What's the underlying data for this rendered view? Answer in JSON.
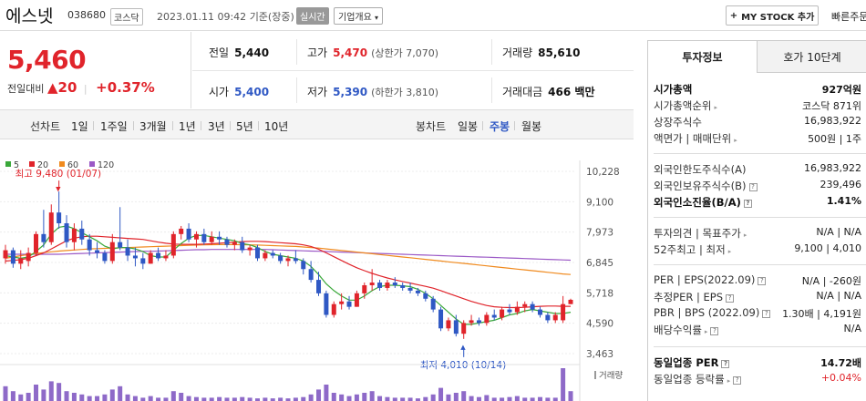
{
  "header": {
    "name": "에스넷",
    "code": "038680",
    "market": "코스닥",
    "datetime": "2023.01.11 09:42",
    "basis": "기준(장중)",
    "realtime": "실시간",
    "company_btn": "기업개요",
    "mystock_btn": "MY STOCK 추가",
    "quick": "빠른주문"
  },
  "price": {
    "now": "5,460",
    "change_label": "전일대비",
    "change_val": "20",
    "change_pct": "+0.37%"
  },
  "stats": {
    "prev_close_lbl": "전일",
    "prev_close": "5,440",
    "high_lbl": "고가",
    "high": "5,470",
    "upper_limit": "(상한가 7,070)",
    "volume_lbl": "거래량",
    "volume": "85,610",
    "open_lbl": "시가",
    "open": "5,400",
    "low_lbl": "저가",
    "low": "5,390",
    "lower_limit": "(하한가 3,810)",
    "amount_lbl": "거래대금",
    "amount": "466 백만"
  },
  "toolbar": {
    "line_label": "선차트",
    "periods": [
      "1일",
      "1주일",
      "3개월",
      "1년",
      "3년",
      "5년",
      "10년"
    ],
    "candle_label": "봉차트",
    "candles": [
      "일봉",
      "주봉",
      "월봉"
    ],
    "candle_active": "주봉"
  },
  "colors": {
    "up": "#e0242b",
    "down": "#2f58c4",
    "ma5": "#3aa83a",
    "ma20": "#e0242b",
    "ma60": "#f08a1e",
    "ma120": "#9b59c6",
    "volume": "#8e6ac8"
  },
  "chart_data": {
    "type": "candlestick",
    "legend": [
      "5",
      "20",
      "60",
      "120"
    ],
    "yticks": [
      "10,228",
      "9,100",
      "7,973",
      "6,845",
      "5,718",
      "4,590",
      "3,463"
    ],
    "ylim": [
      3463,
      10228
    ],
    "high_note": "최고 9,480 (01/07)",
    "low_note": "최저 4,010 (10/14)",
    "volume_label": "거래량",
    "candles": [
      [
        7000,
        7500,
        6800,
        7300
      ],
      [
        7300,
        7400,
        6650,
        6800
      ],
      [
        6800,
        7300,
        6600,
        7000
      ],
      [
        6900,
        7400,
        6700,
        7200
      ],
      [
        7200,
        8000,
        7100,
        7900
      ],
      [
        7900,
        8800,
        7400,
        7600
      ],
      [
        7600,
        9000,
        7500,
        8700
      ],
      [
        8700,
        9480,
        8100,
        8300
      ],
      [
        8300,
        8600,
        7400,
        7600
      ],
      [
        7600,
        8300,
        7300,
        8100
      ],
      [
        8100,
        8400,
        7500,
        7700
      ],
      [
        7700,
        7900,
        7100,
        7300
      ],
      [
        7300,
        7600,
        7000,
        7200
      ],
      [
        7200,
        7300,
        6800,
        6900
      ],
      [
        6900,
        7900,
        6800,
        7600
      ],
      [
        7600,
        8900,
        7300,
        7400
      ],
      [
        7400,
        7700,
        6900,
        7100
      ],
      [
        7100,
        7400,
        6700,
        7000
      ],
      [
        7000,
        7200,
        6600,
        6800
      ],
      [
        6800,
        7300,
        6800,
        7200
      ],
      [
        7200,
        7400,
        6900,
        7000
      ],
      [
        7000,
        7300,
        6900,
        7100
      ],
      [
        7100,
        8000,
        7000,
        7900
      ],
      [
        7900,
        8200,
        7700,
        8100
      ],
      [
        8100,
        8300,
        7600,
        7700
      ],
      [
        7700,
        8000,
        7400,
        7900
      ],
      [
        7900,
        8100,
        7500,
        7600
      ],
      [
        7600,
        8000,
        7500,
        7800
      ],
      [
        7800,
        8000,
        7500,
        7700
      ],
      [
        7700,
        7800,
        7400,
        7500
      ],
      [
        7500,
        7700,
        7300,
        7600
      ],
      [
        7600,
        7800,
        7200,
        7300
      ],
      [
        7300,
        7500,
        7100,
        7400
      ],
      [
        7400,
        7500,
        6900,
        7000
      ],
      [
        7000,
        7300,
        6900,
        7200
      ],
      [
        7200,
        7300,
        7000,
        7100
      ],
      [
        7100,
        7200,
        6800,
        6900
      ],
      [
        6900,
        7100,
        6700,
        7000
      ],
      [
        7000,
        7300,
        6800,
        6900
      ],
      [
        6900,
        7000,
        6400,
        6600
      ],
      [
        6600,
        6900,
        6100,
        6200
      ],
      [
        6200,
        6500,
        5600,
        5700
      ],
      [
        5700,
        5800,
        4800,
        4900
      ],
      [
        4900,
        5400,
        4800,
        5300
      ],
      [
        5300,
        5700,
        5100,
        5400
      ],
      [
        5400,
        5600,
        5100,
        5200
      ],
      [
        5200,
        5800,
        5200,
        5700
      ],
      [
        5700,
        6100,
        5500,
        6000
      ],
      [
        6000,
        6600,
        5800,
        6100
      ],
      [
        6100,
        6200,
        5800,
        5900
      ],
      [
        5900,
        6200,
        5800,
        6100
      ],
      [
        6100,
        6300,
        5900,
        6000
      ],
      [
        6000,
        6100,
        5800,
        5900
      ],
      [
        5900,
        6100,
        5700,
        5800
      ],
      [
        5800,
        5900,
        5600,
        5700
      ],
      [
        5700,
        5800,
        5400,
        5500
      ],
      [
        5500,
        5600,
        5000,
        5100
      ],
      [
        5100,
        5200,
        4300,
        4400
      ],
      [
        4400,
        4800,
        4300,
        4700
      ],
      [
        4700,
        4900,
        4100,
        4200
      ],
      [
        4200,
        4700,
        4010,
        4600
      ],
      [
        4600,
        4900,
        4500,
        4700
      ],
      [
        4700,
        4800,
        4500,
        4600
      ],
      [
        4600,
        5000,
        4500,
        4900
      ],
      [
        4900,
        5100,
        4700,
        4800
      ],
      [
        4800,
        5200,
        4700,
        5100
      ],
      [
        5100,
        5300,
        4900,
        5000
      ],
      [
        5000,
        5400,
        4900,
        5200
      ],
      [
        5200,
        5400,
        5000,
        5300
      ],
      [
        5300,
        5400,
        5000,
        5100
      ],
      [
        5100,
        5200,
        4800,
        4900
      ],
      [
        4900,
        5000,
        4600,
        4700
      ],
      [
        4700,
        5000,
        4600,
        4900
      ],
      [
        4700,
        5600,
        4600,
        5300
      ],
      [
        5300,
        5500,
        5300,
        5460
      ]
    ],
    "ma5": [
      7100,
      7050,
      7000,
      7050,
      7250,
      7500,
      7900,
      8150,
      8200,
      8100,
      7950,
      7800,
      7650,
      7450,
      7350,
      7400,
      7400,
      7350,
      7250,
      7100,
      7050,
      7050,
      7300,
      7550,
      7750,
      7850,
      7850,
      7800,
      7750,
      7700,
      7650,
      7550,
      7500,
      7400,
      7250,
      7150,
      7100,
      7050,
      7000,
      6900,
      6700,
      6400,
      6050,
      5800,
      5600,
      5450,
      5450,
      5600,
      5800,
      5950,
      6000,
      6000,
      5980,
      5950,
      5850,
      5700,
      5500,
      5250,
      5000,
      4750,
      4550,
      4550,
      4600,
      4650,
      4700,
      4800,
      4900,
      4950,
      5050,
      5100,
      5050,
      5000,
      4950,
      4950,
      5000
    ],
    "ma20": [
      6900,
      6920,
      6950,
      7000,
      7100,
      7200,
      7350,
      7500,
      7650,
      7750,
      7800,
      7820,
      7820,
      7800,
      7780,
      7760,
      7740,
      7720,
      7700,
      7650,
      7600,
      7560,
      7530,
      7520,
      7520,
      7520,
      7530,
      7540,
      7560,
      7580,
      7600,
      7620,
      7630,
      7630,
      7620,
      7600,
      7580,
      7560,
      7540,
      7500,
      7440,
      7340,
      7200,
      7060,
      6920,
      6780,
      6650,
      6540,
      6440,
      6350,
      6270,
      6200,
      6140,
      6080,
      6020,
      5960,
      5890,
      5800,
      5700,
      5600,
      5500,
      5400,
      5320,
      5250,
      5200,
      5180,
      5170,
      5170,
      5180,
      5200,
      5220,
      5230,
      5230,
      5220,
      5220
    ],
    "ma60": [
      7000,
      7050,
      7100,
      7140,
      7180,
      7210,
      7240,
      7270,
      7290,
      7310,
      7330,
      7350,
      7360,
      7370,
      7380,
      7390,
      7400,
      7410,
      7420,
      7430,
      7440,
      7450,
      7460,
      7470,
      7480,
      7490,
      7500,
      7505,
      7510,
      7510,
      7510,
      7505,
      7500,
      7490,
      7480,
      7470,
      7460,
      7450,
      7440,
      7420,
      7400,
      7380,
      7350,
      7320,
      7290,
      7260,
      7230,
      7200,
      7170,
      7140,
      7110,
      7080,
      7050,
      7020,
      6990,
      6960,
      6930,
      6900,
      6870,
      6840,
      6810,
      6780,
      6750,
      6720,
      6690,
      6660,
      6630,
      6600,
      6570,
      6540,
      6510,
      6480,
      6450,
      6420,
      6400
    ],
    "ma120": [
      7150,
      7150,
      7150,
      7150,
      7150,
      7150,
      7150,
      7150,
      7160,
      7170,
      7180,
      7190,
      7200,
      7210,
      7220,
      7230,
      7240,
      7250,
      7260,
      7260,
      7270,
      7280,
      7290,
      7300,
      7310,
      7320,
      7320,
      7330,
      7330,
      7330,
      7330,
      7330,
      7330,
      7330,
      7330,
      7320,
      7310,
      7300,
      7290,
      7280,
      7270,
      7260,
      7250,
      7240,
      7230,
      7220,
      7210,
      7200,
      7190,
      7180,
      7170,
      7160,
      7150,
      7140,
      7130,
      7120,
      7110,
      7100,
      7090,
      7080,
      7070,
      7060,
      7050,
      7040,
      7030,
      7020,
      7010,
      7000,
      6990,
      6980,
      6970,
      6960,
      6950,
      6940,
      6930
    ],
    "volumes": [
      0.45,
      0.3,
      0.2,
      0.25,
      0.5,
      0.35,
      0.6,
      0.55,
      0.3,
      0.25,
      0.2,
      0.15,
      0.15,
      0.2,
      0.35,
      0.45,
      0.2,
      0.15,
      0.1,
      0.15,
      0.1,
      0.1,
      0.3,
      0.25,
      0.15,
      0.12,
      0.1,
      0.1,
      0.12,
      0.1,
      0.1,
      0.12,
      0.1,
      0.08,
      0.1,
      0.08,
      0.1,
      0.08,
      0.1,
      0.12,
      0.2,
      0.35,
      0.5,
      0.25,
      0.2,
      0.15,
      0.2,
      0.25,
      0.3,
      0.15,
      0.12,
      0.1,
      0.1,
      0.1,
      0.08,
      0.12,
      0.2,
      0.4,
      0.2,
      0.25,
      0.3,
      0.15,
      0.12,
      0.18,
      0.1,
      0.1,
      0.12,
      0.15,
      0.1,
      0.1,
      0.12,
      0.1,
      0.1,
      1.0,
      0.3
    ]
  },
  "invest": {
    "tab_on": "투자정보",
    "tab_off": "호가 10단계",
    "rows": [
      {
        "k": "시가총액",
        "v": "927억원",
        "bold": true
      },
      {
        "k": "시가총액순위",
        "v": "코스닥 871위"
      },
      {
        "k": "상장주식수",
        "v": "16,983,922"
      },
      {
        "k": "액면가 | 매매단위",
        "v": "500원 | 1주"
      },
      {
        "k": "외국인한도주식수(A)",
        "v": "16,983,922"
      },
      {
        "k": "외국인보유주식수(B)",
        "v": "239,496"
      },
      {
        "k": "외국인소진율(B/A)",
        "v": "1.41%",
        "bold": true
      },
      {
        "k": "투자의견 | 목표주가",
        "v": "N/A | N/A"
      },
      {
        "k": "52주최고 | 최저",
        "v": "9,100 | 4,010"
      },
      {
        "k": "PER | EPS(2022.09)",
        "v": "N/A | -260원"
      },
      {
        "k": "추정PER | EPS",
        "v": "N/A | N/A"
      },
      {
        "k": "PBR | BPS (2022.09)",
        "v": "1.30배 | 4,191원"
      },
      {
        "k": "배당수익률",
        "v": "N/A"
      },
      {
        "k": "동일업종 PER",
        "v": "14.72배",
        "bold": true
      },
      {
        "k": "동일업종 등락률",
        "v": "+0.04%",
        "red": true
      }
    ]
  }
}
